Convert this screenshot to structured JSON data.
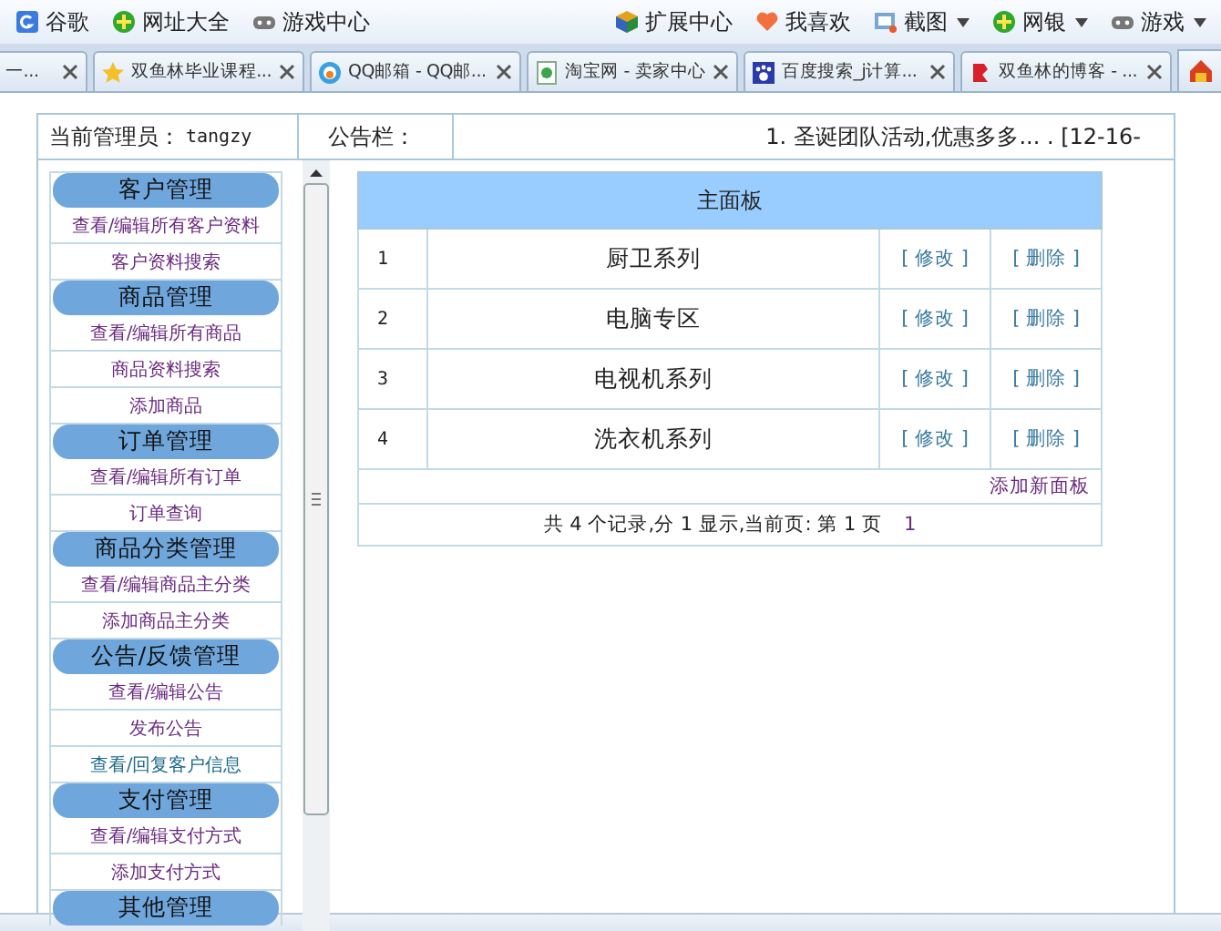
{
  "bookmarks": {
    "left": [
      {
        "label": "谷歌"
      },
      {
        "label": "网址大全"
      },
      {
        "label": "游戏中心"
      }
    ],
    "right": [
      {
        "label": "扩展中心",
        "has_menu": false
      },
      {
        "label": "我喜欢",
        "has_menu": false
      },
      {
        "label": "截图",
        "has_menu": true
      },
      {
        "label": "网银",
        "has_menu": true
      },
      {
        "label": "游戏",
        "has_menu": true
      }
    ]
  },
  "tabs": [
    {
      "label": "一..."
    },
    {
      "label": "双鱼林毕业课程..."
    },
    {
      "label": "QQ邮箱 - QQ邮..."
    },
    {
      "label": "淘宝网 - 卖家中心"
    },
    {
      "label": "百度搜索_j计算..."
    },
    {
      "label": "双鱼林的博客 - ..."
    }
  ],
  "header": {
    "admin_label": "当前管理员：",
    "admin_name": "tangzy",
    "notice_label": "公告栏：",
    "notice": "1. 圣诞团队活动,优惠多多... . [12-16-"
  },
  "sidebar": {
    "groups": [
      {
        "title": "客户管理",
        "items": [
          {
            "label": "查看/编辑所有客户资料",
            "visited": true
          },
          {
            "label": "客户资料搜索",
            "visited": true
          }
        ]
      },
      {
        "title": "商品管理",
        "items": [
          {
            "label": "查看/编辑所有商品",
            "visited": true
          },
          {
            "label": "商品资料搜索",
            "visited": true
          },
          {
            "label": "添加商品",
            "visited": true
          }
        ]
      },
      {
        "title": "订单管理",
        "items": [
          {
            "label": "查看/编辑所有订单",
            "visited": true
          },
          {
            "label": "订单查询",
            "visited": true
          }
        ]
      },
      {
        "title": "商品分类管理",
        "items": [
          {
            "label": "查看/编辑商品主分类",
            "visited": true
          },
          {
            "label": "添加商品主分类",
            "visited": true
          }
        ]
      },
      {
        "title": "公告/反馈管理",
        "items": [
          {
            "label": "查看/编辑公告",
            "visited": true
          },
          {
            "label": "发布公告",
            "visited": true
          },
          {
            "label": "查看/回复客户信息",
            "visited": false
          }
        ]
      },
      {
        "title": "支付管理",
        "items": [
          {
            "label": "查看/编辑支付方式",
            "visited": true
          },
          {
            "label": "添加支付方式",
            "visited": true
          }
        ]
      },
      {
        "title": "其他管理"
      }
    ]
  },
  "panel": {
    "title": "主面板",
    "rows": [
      {
        "index": "1",
        "name": "厨卫系列",
        "edit": "[ 修改 ]",
        "delete": "[ 删除 ]"
      },
      {
        "index": "2",
        "name": "电脑专区",
        "edit": "[ 修改 ]",
        "delete": "[ 删除 ]"
      },
      {
        "index": "3",
        "name": "电视机系列",
        "edit": "[ 修改 ]",
        "delete": "[ 删除 ]"
      },
      {
        "index": "4",
        "name": "洗衣机系列",
        "edit": "[ 修改 ]",
        "delete": "[ 删除 ]"
      }
    ],
    "add_link": "添加新面板",
    "pager": "共 4 个记录,分 1 显示,当前页: 第 1 页",
    "page_link": "1"
  }
}
